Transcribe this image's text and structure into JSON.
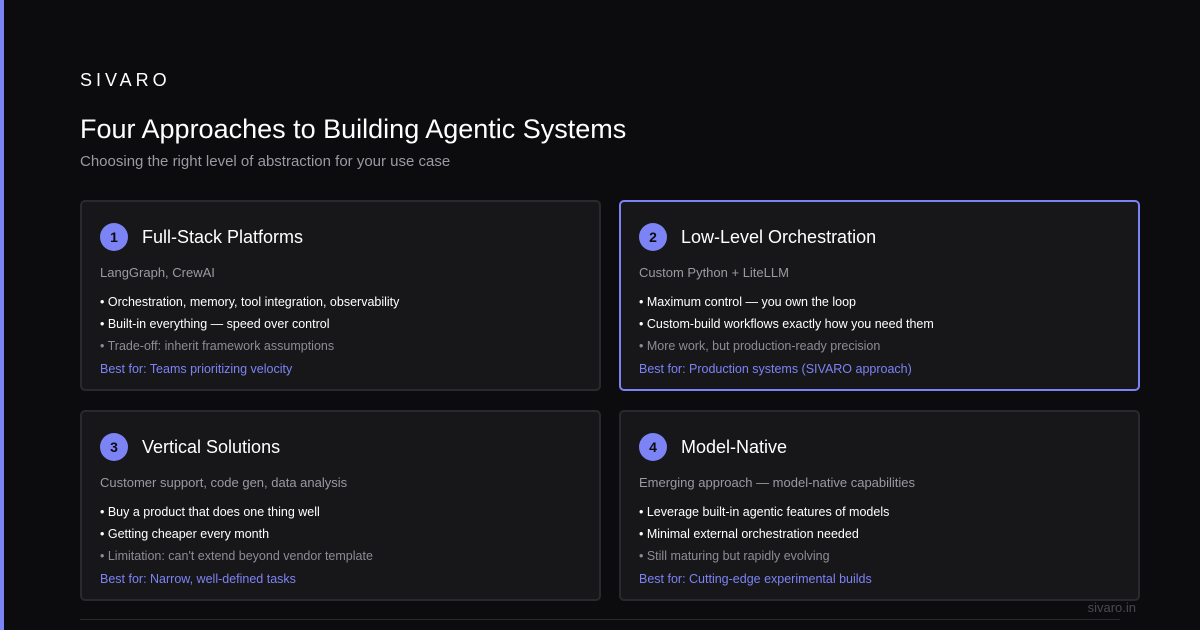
{
  "brand": "SIVARO",
  "title": "Four Approaches to Building Agentic Systems",
  "subtitle": "Choosing the right level of abstraction for your use case",
  "colors": {
    "accent": "#7c83f5",
    "background": "#0c0c0e",
    "card": "#17171a"
  },
  "cards": [
    {
      "number": "1",
      "title": "Full-Stack Platforms",
      "tools": "LangGraph, CrewAI",
      "bullets": [
        "• Orchestration, memory, tool integration, observability",
        "• Built-in everything — speed over control",
        "• Trade-off: inherit framework assumptions"
      ],
      "best_for": "Best for: Teams prioritizing velocity"
    },
    {
      "number": "2",
      "title": "Low-Level Orchestration",
      "tools": "Custom Python + LiteLLM",
      "bullets": [
        "• Maximum control — you own the loop",
        "• Custom-build workflows exactly how you need them",
        "• More work, but production-ready precision"
      ],
      "best_for": "Best for: Production systems (SIVARO approach)"
    },
    {
      "number": "3",
      "title": "Vertical Solutions",
      "tools": "Customer support, code gen, data analysis",
      "bullets": [
        "• Buy a product that does one thing well",
        "• Getting cheaper every month",
        "• Limitation: can't extend beyond vendor template"
      ],
      "best_for": "Best for: Narrow, well-defined tasks"
    },
    {
      "number": "4",
      "title": "Model-Native",
      "tools": "Emerging approach — model-native capabilities",
      "bullets": [
        "• Leverage built-in agentic features of models",
        "• Minimal external orchestration needed",
        "• Still maturing but rapidly evolving"
      ],
      "best_for": "Best for: Cutting-edge experimental builds"
    }
  ],
  "footer": {
    "url": "sivaro.in"
  }
}
